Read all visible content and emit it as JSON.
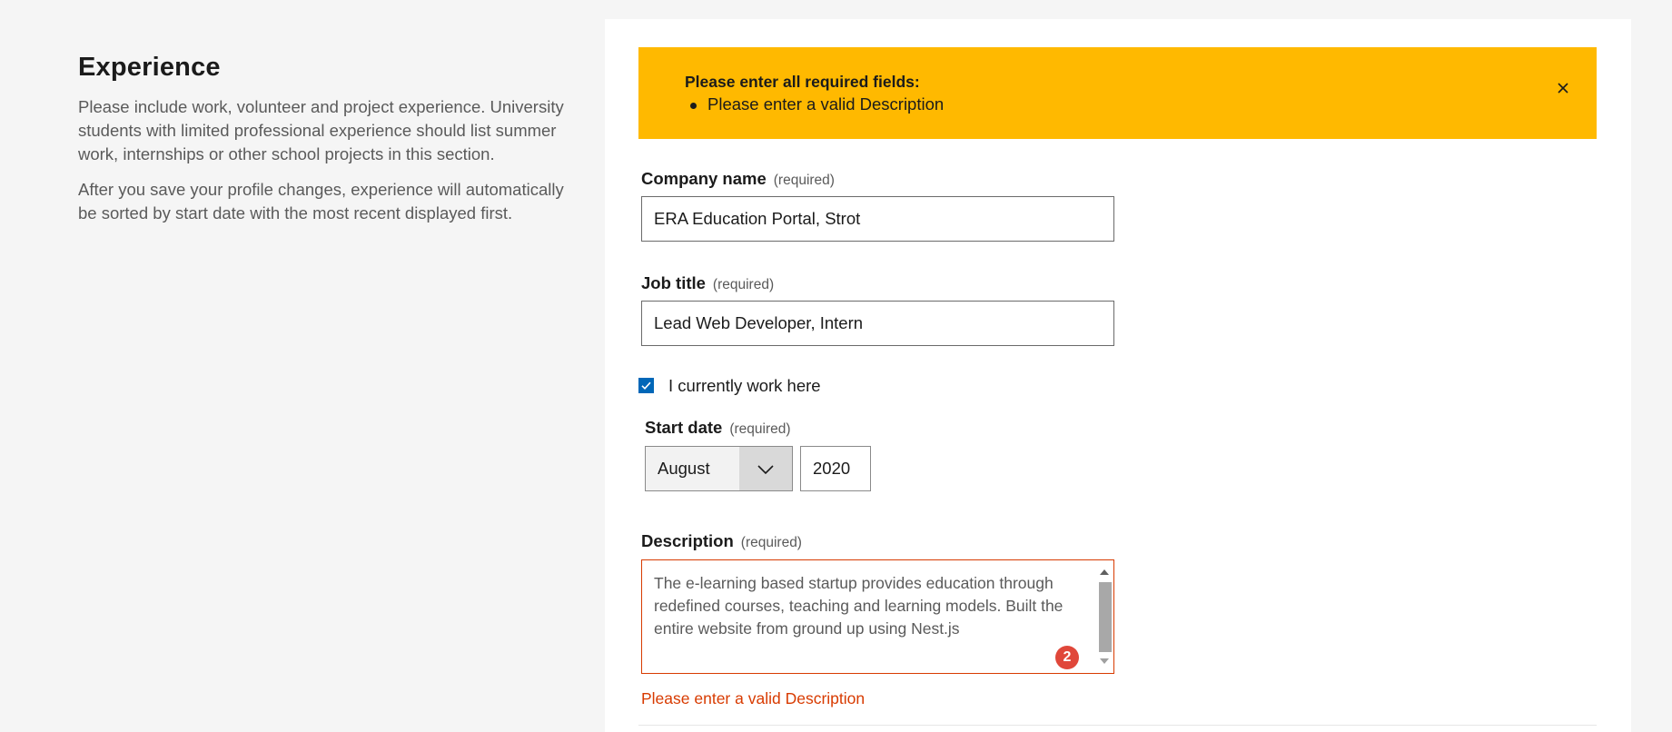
{
  "intro": {
    "heading": "Experience",
    "paragraph1": "Please include work, volunteer and project experience. University students with limited professional experience should list summer work, internships or other school projects in this section.",
    "paragraph2": "After you save your profile changes, experience will automatically be sorted by start date with the most recent displayed first."
  },
  "alert": {
    "title": "Please enter all required fields:",
    "items": [
      "Please enter a valid Description"
    ],
    "close_icon": "close-icon",
    "color": "#ffb900"
  },
  "form": {
    "company": {
      "label": "Company name",
      "required": "(required)",
      "value": "ERA Education Portal, Strot"
    },
    "job_title": {
      "label": "Job title",
      "required": "(required)",
      "value": "Lead Web Developer, Intern"
    },
    "current": {
      "label": "I currently work here",
      "checked": true
    },
    "start_date": {
      "label": "Start date",
      "required": "(required)",
      "month": "August",
      "year": "2020"
    },
    "description": {
      "label": "Description",
      "required": "(required)",
      "value": "The e-learning based startup provides education through\nredefined courses, teaching and learning models. Built the\nentire website from ground up using Nest.js",
      "badge": "2",
      "error": "Please enter a valid Description",
      "error_color": "#d83b01"
    }
  }
}
